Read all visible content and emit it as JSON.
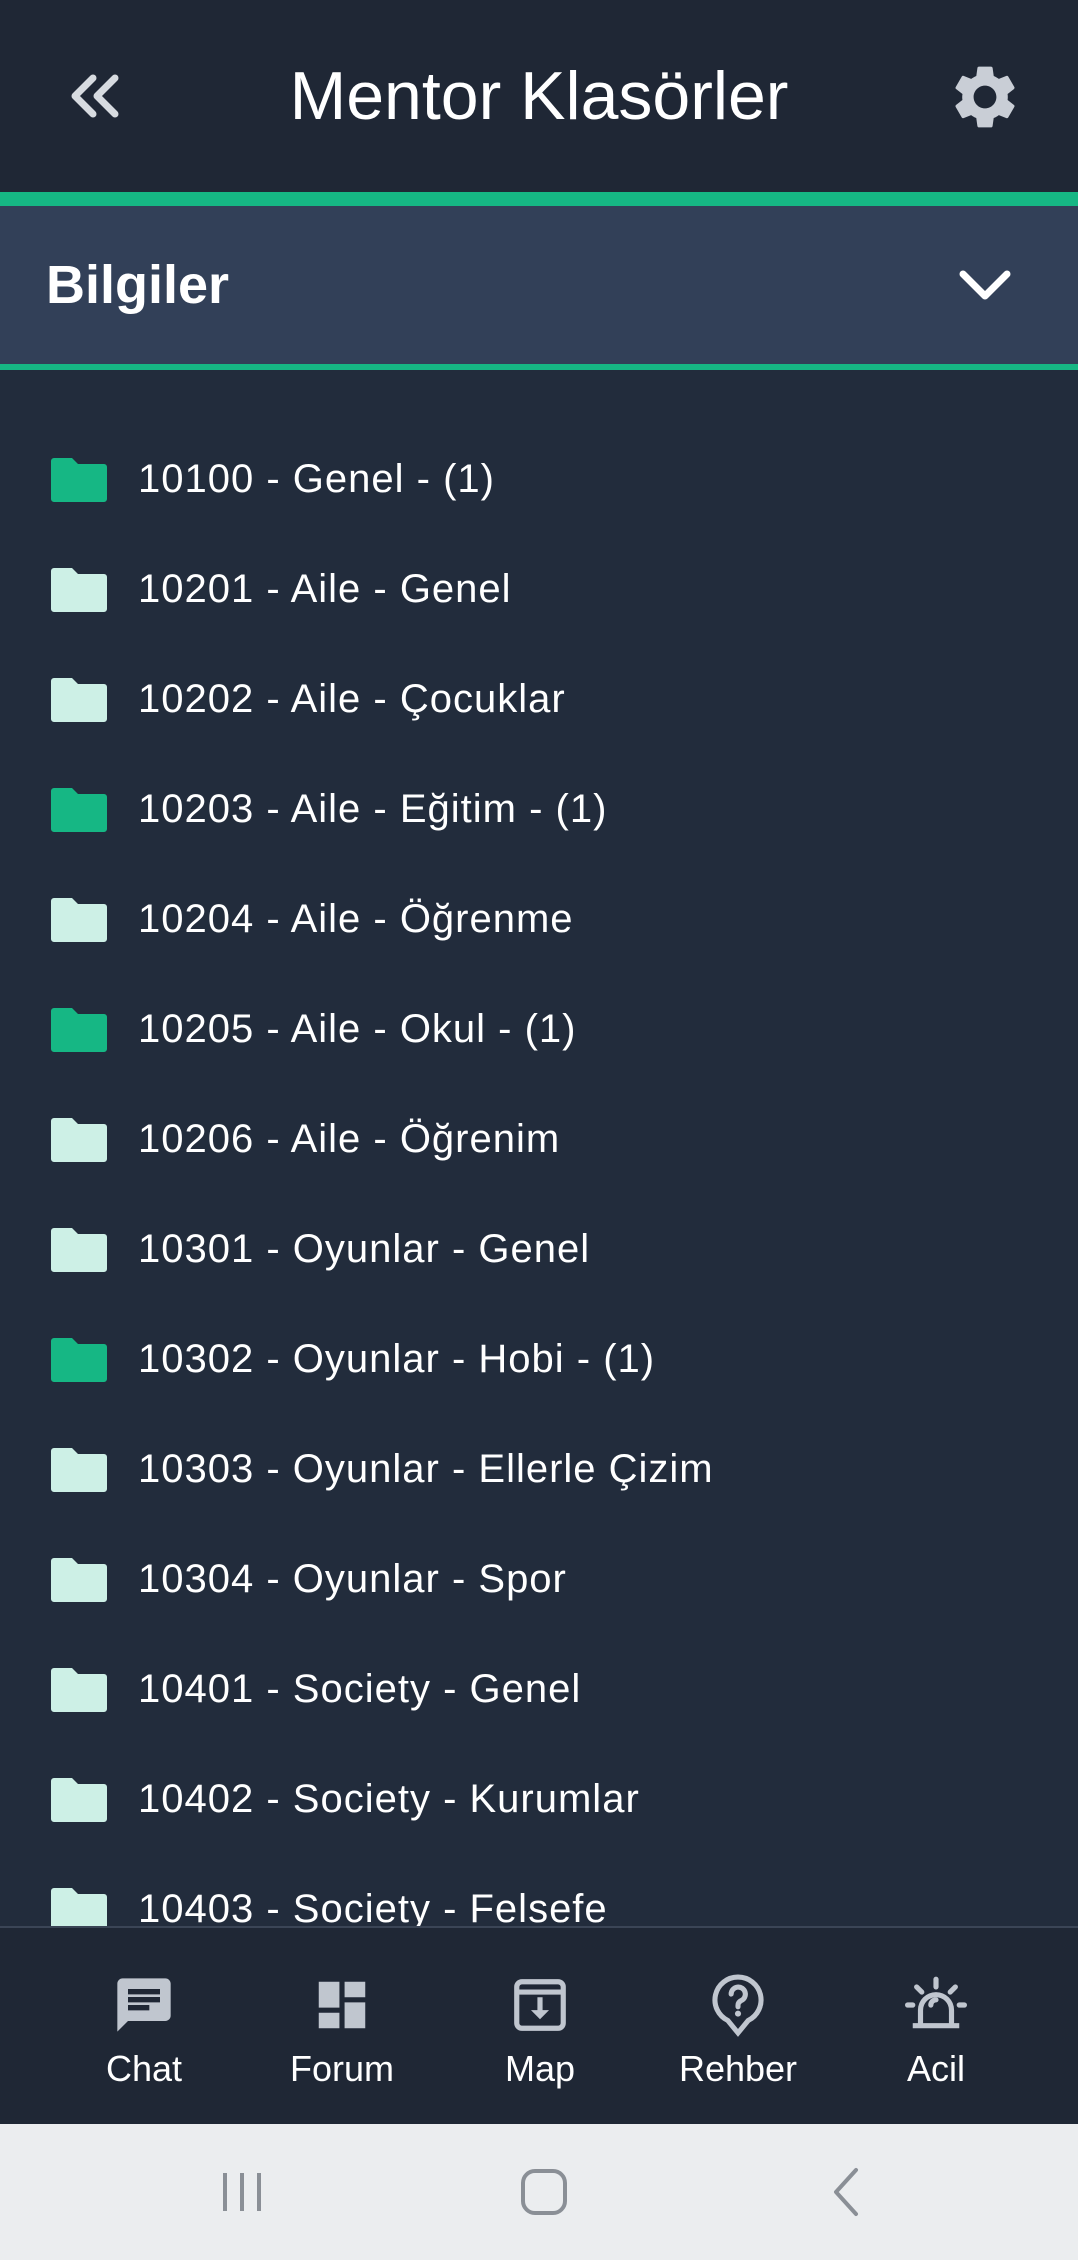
{
  "header": {
    "title": "Mentor Klasörler",
    "back_icon": "double-chevron-left-icon",
    "settings_icon": "gear-icon"
  },
  "accordion": {
    "title": "Bilgiler",
    "chevron_icon": "chevron-down-icon"
  },
  "colors": {
    "accent": "#16b784",
    "folder_active": "#16b784",
    "folder_inactive": "#cdf0e6",
    "background": "#222c3c",
    "header_bg": "#1f2735",
    "accordion_bg": "#324058"
  },
  "folders": [
    {
      "label": "10100 - Genel - (1)",
      "active": true
    },
    {
      "label": "10201 - Aile - Genel",
      "active": false
    },
    {
      "label": "10202 - Aile - Çocuklar",
      "active": false
    },
    {
      "label": "10203 - Aile - Eğitim - (1)",
      "active": true
    },
    {
      "label": "10204 - Aile - Öğrenme",
      "active": false
    },
    {
      "label": "10205 - Aile - Okul - (1)",
      "active": true
    },
    {
      "label": "10206 - Aile - Öğrenim",
      "active": false
    },
    {
      "label": "10301 - Oyunlar - Genel",
      "active": false
    },
    {
      "label": "10302 - Oyunlar - Hobi - (1)",
      "active": true
    },
    {
      "label": "10303 - Oyunlar - Ellerle Çizim",
      "active": false
    },
    {
      "label": "10304 - Oyunlar - Spor",
      "active": false
    },
    {
      "label": "10401 - Society - Genel",
      "active": false
    },
    {
      "label": "10402 - Society - Kurumlar",
      "active": false
    },
    {
      "label": "10403 - Society - Felsefe",
      "active": false
    }
  ],
  "bottom_nav": [
    {
      "label": "Chat",
      "icon": "chat-icon"
    },
    {
      "label": "Forum",
      "icon": "dashboard-icon"
    },
    {
      "label": "Map",
      "icon": "archive-download-icon"
    },
    {
      "label": "Rehber",
      "icon": "help-icon"
    },
    {
      "label": "Acil",
      "icon": "alarm-light-icon"
    }
  ],
  "system_nav": {
    "recents_icon": "recents-icon",
    "home_icon": "home-icon",
    "back_icon": "back-icon"
  }
}
